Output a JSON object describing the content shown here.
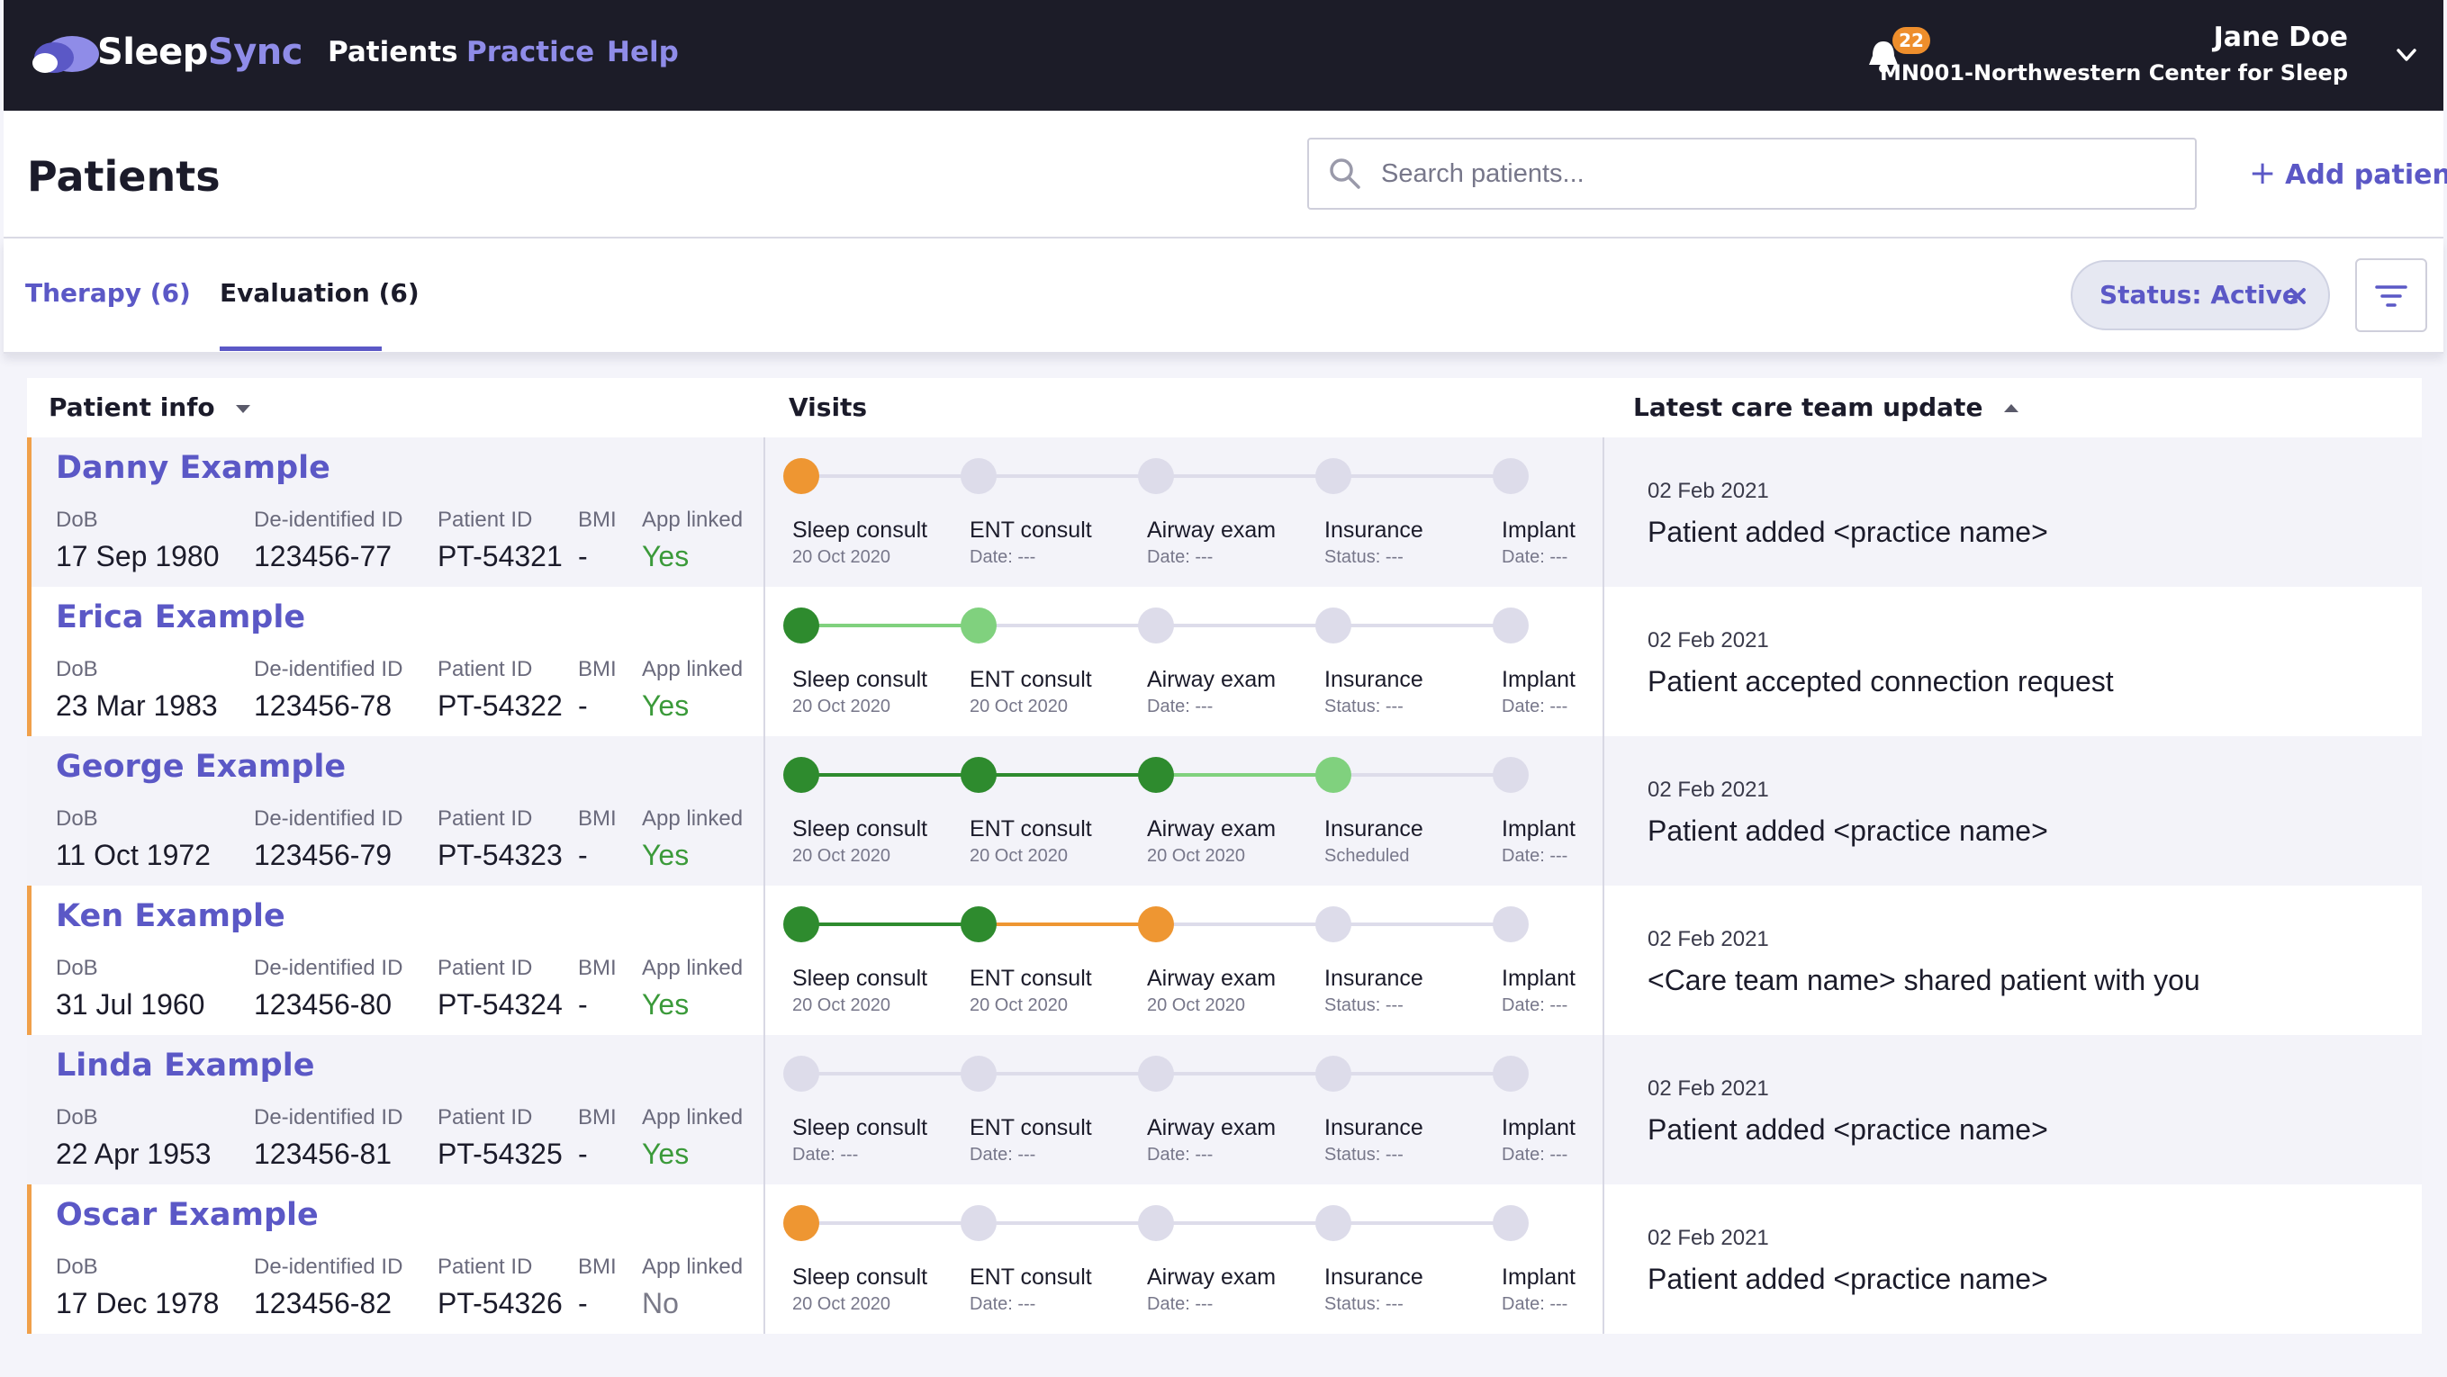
{
  "app": {
    "logo_part1": "Sleep",
    "logo_part2": "Sync",
    "nav": {
      "patients": "Patients",
      "practice": "Practice",
      "help": "Help"
    },
    "notifications_count": "22",
    "user": {
      "name": "Jane Doe",
      "org": "MN001-Northwestern Center for Sleep"
    }
  },
  "header": {
    "title": "Patients",
    "search_placeholder": "Search patients...",
    "add_patient": "Add patient"
  },
  "tabs": {
    "therapy": "Therapy (6)",
    "evaluation": "Evaluation (6)",
    "active": "evaluation"
  },
  "filters": {
    "status_chip": "Status: Active"
  },
  "table": {
    "headers": {
      "info": "Patient info",
      "visits": "Visits",
      "update": "Latest care team update"
    },
    "field_labels": {
      "dob": "DoB",
      "deid": "De-identified ID",
      "pid": "Patient ID",
      "bmi": "BMI",
      "app": "App linked"
    },
    "visit_names": [
      "Sleep consult",
      "ENT consult",
      "Airway exam",
      "Insurance",
      "Implant"
    ],
    "rows": [
      {
        "name": "Danny Example",
        "dob": "17 Sep 1980",
        "deid": "123456-77",
        "pid": "PT-54321",
        "bmi": "-",
        "app": "Yes",
        "flagged": true,
        "visits": [
          {
            "state": "current",
            "date": "20 Oct 2020"
          },
          {
            "state": "pending",
            "date": "Date: ---"
          },
          {
            "state": "pending",
            "date": "Date: ---"
          },
          {
            "state": "pending",
            "date": "Status: ---"
          },
          {
            "state": "pending",
            "date": "Date: ---"
          }
        ],
        "update_date": "02 Feb 2021",
        "update_text": "Patient added <practice name>"
      },
      {
        "name": "Erica Example",
        "dob": "23 Mar 1983",
        "deid": "123456-78",
        "pid": "PT-54322",
        "bmi": "-",
        "app": "Yes",
        "flagged": true,
        "visits": [
          {
            "state": "done",
            "date": "20 Oct 2020"
          },
          {
            "state": "next",
            "date": "20 Oct 2020"
          },
          {
            "state": "pending",
            "date": "Date: ---"
          },
          {
            "state": "pending",
            "date": "Status: ---"
          },
          {
            "state": "pending",
            "date": "Date: ---"
          }
        ],
        "update_date": "02 Feb 2021",
        "update_text": "Patient accepted connection request"
      },
      {
        "name": "George Example",
        "dob": "11 Oct 1972",
        "deid": "123456-79",
        "pid": "PT-54323",
        "bmi": "-",
        "app": "Yes",
        "flagged": false,
        "visits": [
          {
            "state": "done",
            "date": "20 Oct 2020"
          },
          {
            "state": "done",
            "date": "20 Oct 2020"
          },
          {
            "state": "done",
            "date": "20 Oct 2020"
          },
          {
            "state": "next",
            "date": "Scheduled"
          },
          {
            "state": "pending",
            "date": "Date: ---"
          }
        ],
        "update_date": "02 Feb 2021",
        "update_text": "Patient added <practice name>"
      },
      {
        "name": "Ken Example",
        "dob": "31 Jul 1960",
        "deid": "123456-80",
        "pid": "PT-54324",
        "bmi": "-",
        "app": "Yes",
        "flagged": true,
        "visits": [
          {
            "state": "done",
            "date": "20 Oct 2020"
          },
          {
            "state": "done",
            "date": "20 Oct 2020"
          },
          {
            "state": "current",
            "date": "20 Oct 2020"
          },
          {
            "state": "pending",
            "date": "Status: ---"
          },
          {
            "state": "pending",
            "date": "Date: ---"
          }
        ],
        "update_date": "02 Feb 2021",
        "update_text": "<Care team name> shared patient with you"
      },
      {
        "name": "Linda Example",
        "dob": "22 Apr 1953",
        "deid": "123456-81",
        "pid": "PT-54325",
        "bmi": "-",
        "app": "Yes",
        "flagged": false,
        "visits": [
          {
            "state": "pending",
            "date": "Date: ---"
          },
          {
            "state": "pending",
            "date": "Date: ---"
          },
          {
            "state": "pending",
            "date": "Date: ---"
          },
          {
            "state": "pending",
            "date": "Status: ---"
          },
          {
            "state": "pending",
            "date": "Date: ---"
          }
        ],
        "update_date": "02 Feb 2021",
        "update_text": "Patient added <practice name>"
      },
      {
        "name": "Oscar Example",
        "dob": "17 Dec 1978",
        "deid": "123456-82",
        "pid": "PT-54326",
        "bmi": "-",
        "app": "No",
        "flagged": true,
        "visits": [
          {
            "state": "current",
            "date": "20 Oct 2020"
          },
          {
            "state": "pending",
            "date": "Date: ---"
          },
          {
            "state": "pending",
            "date": "Date: ---"
          },
          {
            "state": "pending",
            "date": "Status: ---"
          },
          {
            "state": "pending",
            "date": "Date: ---"
          }
        ],
        "update_date": "02 Feb 2021",
        "update_text": "Patient added <practice name>"
      }
    ]
  },
  "colors": {
    "nav_bg": "#1c1c28",
    "accent": "#5b58c6",
    "done": "#2e8b2e",
    "next": "#80d17e",
    "current": "#ee9632",
    "pending": "#dddcea",
    "flag": "#f0a04a"
  },
  "icons": {
    "logo": "cloud-logo-icon",
    "bell": "bell-icon",
    "chevron": "chevron-down-icon",
    "search": "search-icon",
    "plus": "plus-icon",
    "close": "close-icon",
    "filter": "filter-icon",
    "sort_desc": "caret-down-icon",
    "sort_asc": "caret-up-icon"
  }
}
